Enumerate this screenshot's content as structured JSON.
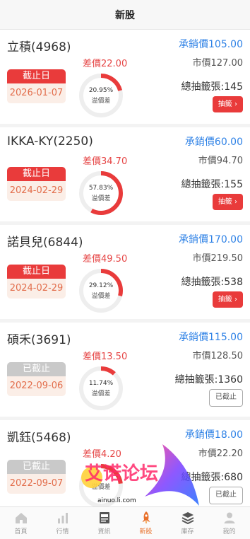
{
  "header": {
    "title": "新股"
  },
  "stocks": [
    {
      "name": "立積(4968)",
      "diff": "差價22.00",
      "status": "截止日",
      "date": "2026-01-07",
      "closed": false,
      "ratio": 0.2095,
      "pct": "20.95%",
      "ratio_label": "溢價差",
      "offer": "承銷價105.00",
      "market": "市價127.00",
      "lots": "總抽籤張:145",
      "button": "抽籤 ›"
    },
    {
      "name": "IKKA-KY(2250)",
      "diff": "差價34.70",
      "status": "截止日",
      "date": "2024-02-29",
      "closed": false,
      "ratio": 0.5783,
      "pct": "57.83%",
      "ratio_label": "溢價差",
      "offer": "承銷價60.00",
      "market": "市價94.70",
      "lots": "總抽籤張:155",
      "button": "抽籤 ›"
    },
    {
      "name": "諾貝兒(6844)",
      "diff": "差價49.50",
      "status": "截止日",
      "date": "2024-02-29",
      "closed": false,
      "ratio": 0.2912,
      "pct": "29.12%",
      "ratio_label": "溢價差",
      "offer": "承銷價170.00",
      "market": "市價219.50",
      "lots": "總抽籤張:538",
      "button": "抽籤 ›"
    },
    {
      "name": "碩禾(3691)",
      "diff": "差價13.50",
      "status": "已截止",
      "date": "2022-09-06",
      "closed": true,
      "ratio": 0.1174,
      "pct": "11.74%",
      "ratio_label": "溢價差",
      "offer": "承銷價115.00",
      "market": "市價128.50",
      "lots": "總抽籤張:1360",
      "button": "已截止"
    },
    {
      "name": "凱鈺(5468)",
      "diff": "差價4.20",
      "status": "已截止",
      "date": "2022-09-07",
      "closed": true,
      "ratio": 0.23,
      "pct": "",
      "ratio_label": "溢價差",
      "offer": "承銷價18.00",
      "market": "市價22.20",
      "lots": "總抽籤張:680",
      "button": "已截止"
    }
  ],
  "tabs": [
    {
      "label": "首頁",
      "icon": "home-icon"
    },
    {
      "label": "行情",
      "icon": "chart-icon"
    },
    {
      "label": "資訊",
      "icon": "news-icon"
    },
    {
      "label": "新股",
      "icon": "rocket-icon",
      "active": true
    },
    {
      "label": "庫存",
      "icon": "layers-icon"
    },
    {
      "label": "我的",
      "icon": "user-icon"
    }
  ],
  "watermark": {
    "text": "艾诺论坛",
    "url": "ainuo.li.com"
  },
  "colors": {
    "accent": "#e93b3b",
    "offer": "#2f82e6",
    "ring_track": "#eeeeee",
    "tab_active": "#e8702a"
  }
}
